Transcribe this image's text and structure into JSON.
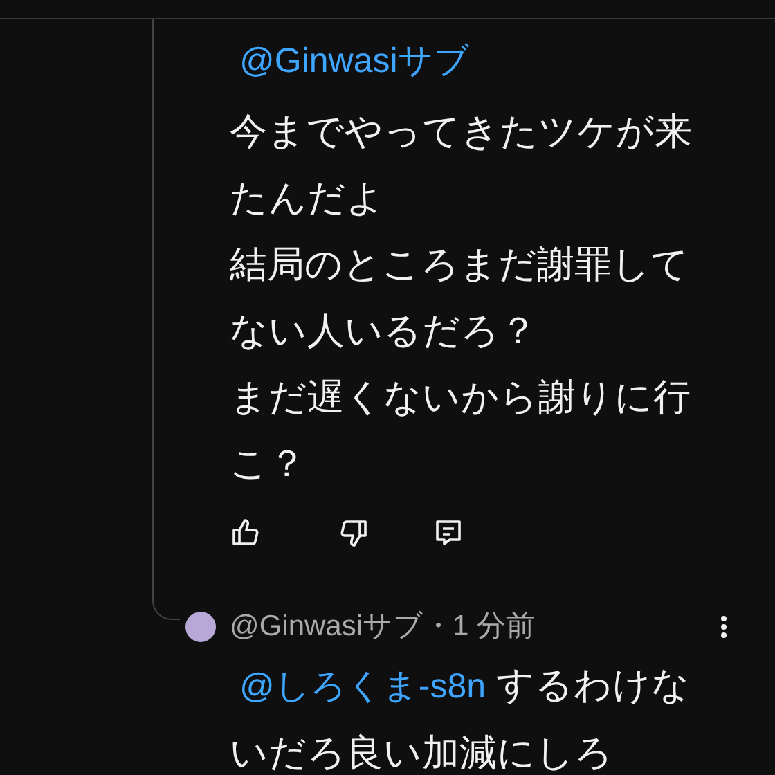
{
  "comment": {
    "mention": "@Ginwasiサブ",
    "lines": [
      "今までやってきたツケが来たんだよ",
      "結局のところまだ謝罪してない人いるだろ？",
      "まだ遅くないから謝りに行こ？"
    ]
  },
  "reply": {
    "meta": "@Ginwasiサブ・1 分前",
    "mention": "@しろくま-s8n",
    "text": "するわけないだろ良い加減にしろ"
  }
}
